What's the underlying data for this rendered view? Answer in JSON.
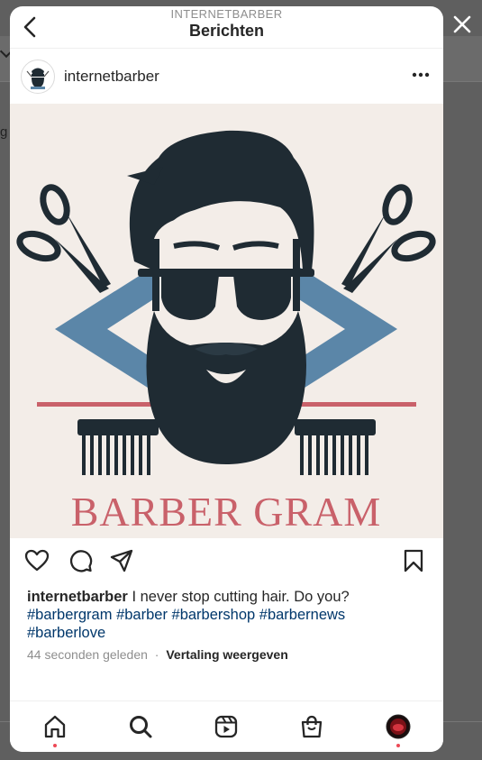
{
  "header": {
    "subtitle": "INTERNETBARBER",
    "title": "Berichten"
  },
  "background": {
    "fragment": "g"
  },
  "post": {
    "username": "internetbarber",
    "image_text": "BARBER GRAM",
    "caption_user": "internetbarber",
    "caption_text": "I never stop cutting hair. Do you?",
    "hashtags": [
      "#barbergram",
      "#barber",
      "#barbershop",
      "#barbernews",
      "#barberlove"
    ],
    "timestamp": "44 seconden geleden",
    "separator": "·",
    "translate_label": "Vertaling weergeven"
  },
  "icons": {
    "back": "chevron-left-icon",
    "close": "close-icon",
    "more": "more-options-icon",
    "like": "heart-icon",
    "comment": "comment-icon",
    "share": "send-icon",
    "save": "bookmark-icon",
    "home": "home-icon",
    "search": "search-icon",
    "reels": "reels-icon",
    "shop": "shop-icon",
    "profile": "profile-avatar-icon"
  },
  "colors": {
    "link": "#00376b",
    "notification_dot": "#ed4956",
    "image_text": "#c9616a",
    "diamond": "#5b86a8",
    "ink": "#1f2b33"
  }
}
